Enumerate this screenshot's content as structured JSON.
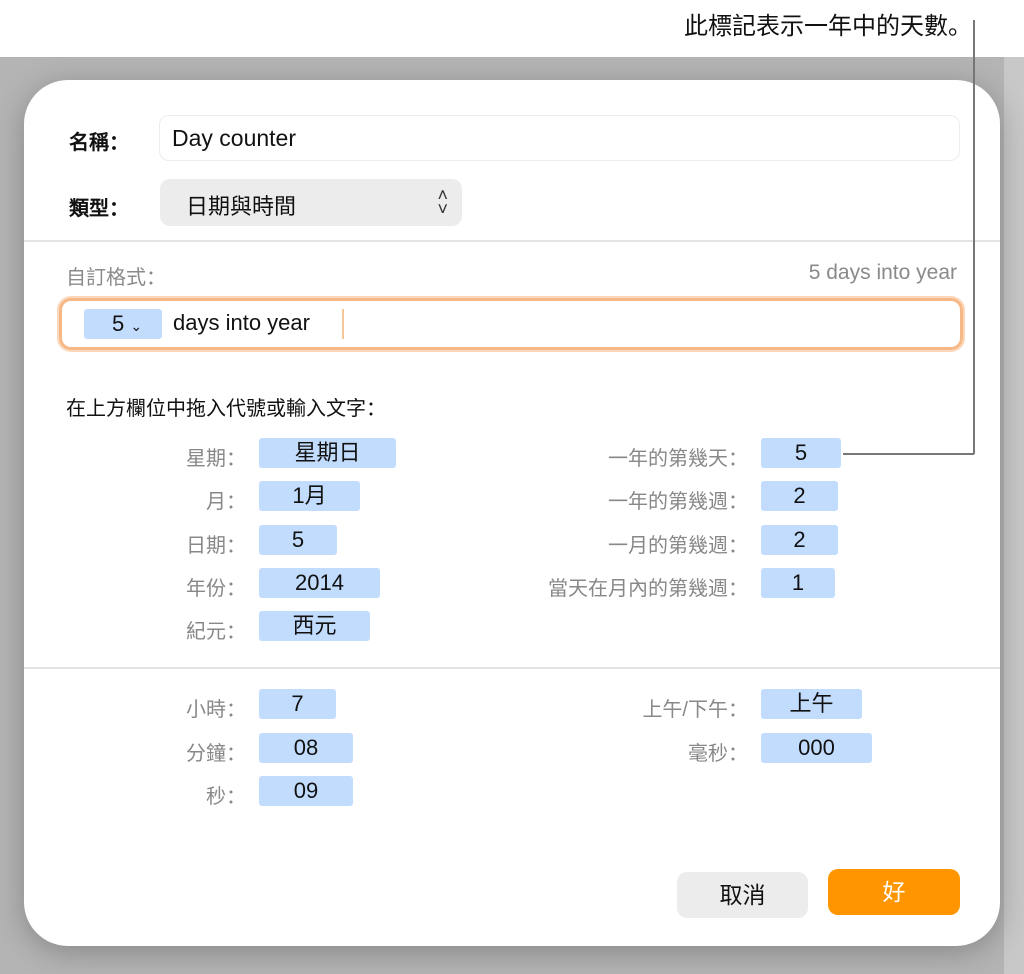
{
  "callout": "此標記表示一年中的天數。",
  "name": {
    "label": "名稱：",
    "value": "Day counter"
  },
  "type": {
    "label": "類型：",
    "value": "日期與時間"
  },
  "custom_format": {
    "label": "自訂格式：",
    "preview": "5 days into year",
    "token": "5",
    "text": "days into year"
  },
  "instructions": "在上方欄位中拖入代號或輸入文字：",
  "date_left": [
    {
      "label": "星期：",
      "value": "星期日"
    },
    {
      "label": "月：",
      "value": "1月"
    },
    {
      "label": "日期：",
      "value": "5"
    },
    {
      "label": "年份：",
      "value": "2014"
    },
    {
      "label": "紀元：",
      "value": "西元"
    }
  ],
  "date_right": [
    {
      "label": "一年的第幾天：",
      "value": "5"
    },
    {
      "label": "一年的第幾週：",
      "value": "2"
    },
    {
      "label": "一月的第幾週：",
      "value": "2"
    },
    {
      "label": "當天在月內的第幾週：",
      "value": "1"
    }
  ],
  "time_left": [
    {
      "label": "小時：",
      "value": "7"
    },
    {
      "label": "分鐘：",
      "value": "08"
    },
    {
      "label": "秒：",
      "value": "09"
    }
  ],
  "time_right": [
    {
      "label": "上午/下午：",
      "value": "上午"
    },
    {
      "label": "毫秒：",
      "value": "000"
    }
  ],
  "buttons": {
    "cancel": "取消",
    "ok": "好"
  }
}
